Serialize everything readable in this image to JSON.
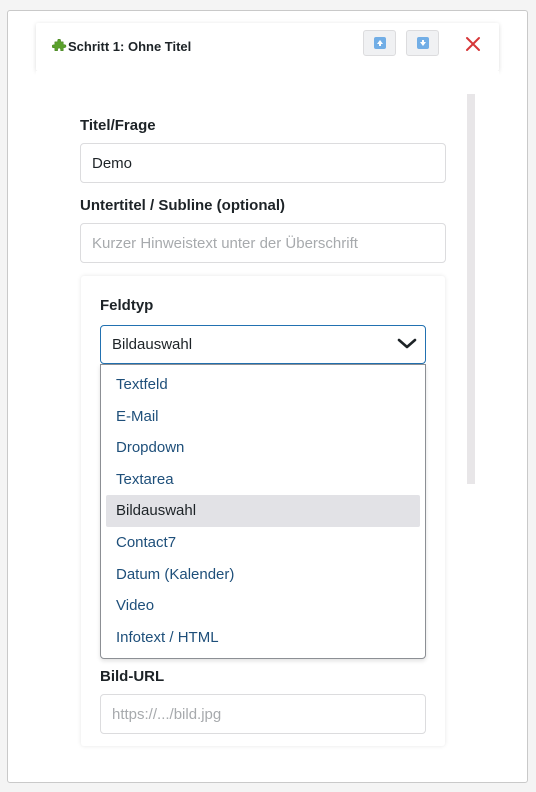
{
  "step": {
    "title": "Schritt 1: Ohne Titel",
    "icon": "puzzle-icon",
    "move_up_icon": "arrow-up-icon",
    "move_down_icon": "arrow-down-icon",
    "close_icon": "close-icon"
  },
  "form": {
    "title_label": "Titel/Frage",
    "title_value": "Demo",
    "subtitle_label": "Untertitel / Subline (optional)",
    "subtitle_placeholder": "Kurzer Hinweistext unter der Überschrift",
    "field_type_label": "Feldtyp",
    "field_type_selected": "Bildauswahl",
    "image_url_label": "Bild-URL",
    "image_url_placeholder": "https://.../bild.jpg"
  },
  "dropdown": {
    "options": [
      "Textfeld",
      "E-Mail",
      "Dropdown",
      "Textarea",
      "Bildauswahl",
      "Contact7",
      "Datum (Kalender)",
      "Video",
      "Infotext / HTML"
    ],
    "selected_index": 4
  },
  "colors": {
    "accent": "#2271b1",
    "close": "#d63638",
    "option_text": "#1e4f7a",
    "selected_bg": "#e2e2e6"
  }
}
